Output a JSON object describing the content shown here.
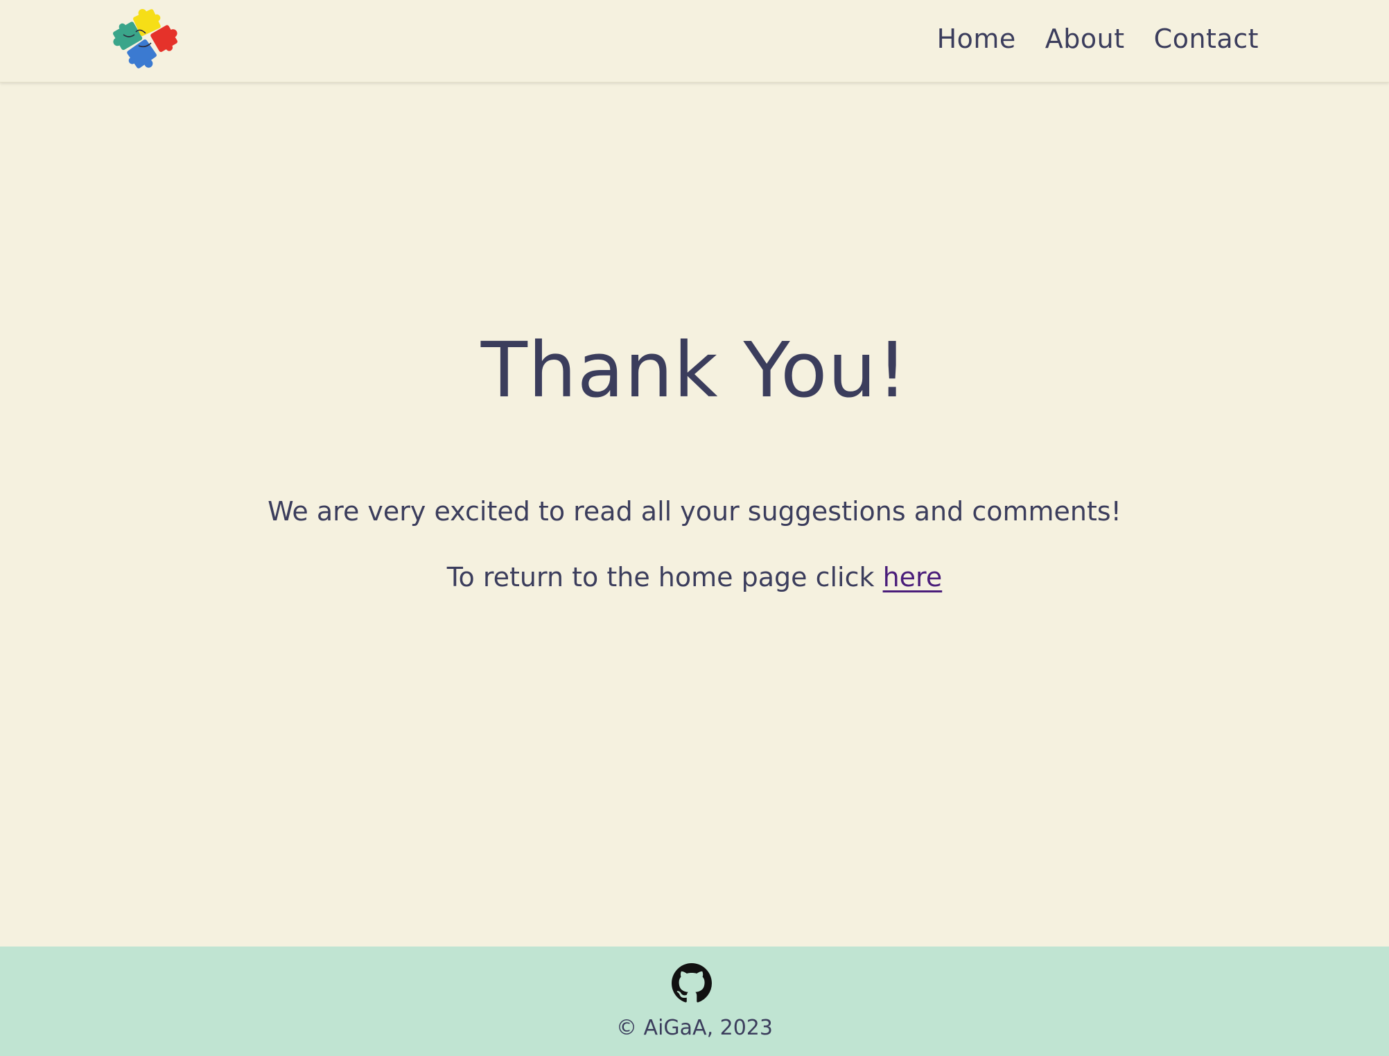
{
  "header": {
    "logo_icon": "puzzle-pieces-logo",
    "nav": [
      {
        "label": "Home"
      },
      {
        "label": "About"
      },
      {
        "label": "Contact"
      }
    ]
  },
  "main": {
    "title": "Thank You!",
    "message": "We are very excited to read all your suggestions and comments!",
    "return_text": "To return to the home page click ",
    "return_link": "here"
  },
  "footer": {
    "icon": "github-icon",
    "copyright": "© AiGaA, 2023"
  },
  "colors": {
    "background": "#f5f1df",
    "text": "#3b3d5c",
    "link": "#4a1d7a",
    "footer_bg": "#c0e4d2",
    "puzzle_teal": "#3aa58a",
    "puzzle_yellow": "#f6de17",
    "puzzle_red": "#e5322a",
    "puzzle_blue": "#3b7ad1"
  }
}
